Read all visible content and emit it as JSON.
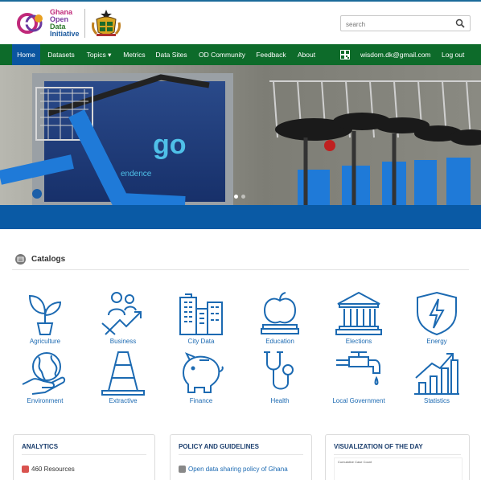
{
  "header": {
    "logo_lines": [
      "Ghana",
      "Open",
      "Data",
      "Initiative"
    ],
    "search_placeholder": "search"
  },
  "nav": {
    "items": [
      {
        "label": "Home",
        "active": true
      },
      {
        "label": "Datasets"
      },
      {
        "label": "Topics ▾"
      },
      {
        "label": "Metrics"
      },
      {
        "label": "Data Sites"
      },
      {
        "label": "OD Community"
      },
      {
        "label": "Feedback"
      },
      {
        "label": "About"
      }
    ],
    "user_email": "wisdom.dk@gmail.com",
    "logout": "Log out"
  },
  "hero": {
    "sign_text": "go",
    "sign_sub": "endence",
    "slides": 2,
    "active_slide": 0
  },
  "catalogs": {
    "title": "Catalogs",
    "items": [
      {
        "label": "Agriculture",
        "icon": "plant-icon"
      },
      {
        "label": "Business",
        "icon": "business-growth-icon"
      },
      {
        "label": "City Data",
        "icon": "city-buildings-icon"
      },
      {
        "label": "Education",
        "icon": "apple-books-icon"
      },
      {
        "label": "Elections",
        "icon": "government-building-icon"
      },
      {
        "label": "Energy",
        "icon": "lightning-shield-icon"
      },
      {
        "label": "Environment",
        "icon": "globe-hand-icon"
      },
      {
        "label": "Extractive",
        "icon": "cone-icon"
      },
      {
        "label": "Finance",
        "icon": "piggy-bank-icon"
      },
      {
        "label": "Health",
        "icon": "stethoscope-icon"
      },
      {
        "label": "Local Government",
        "icon": "water-tap-icon"
      },
      {
        "label": "Statistics",
        "icon": "bar-chart-icon"
      }
    ]
  },
  "panels": {
    "analytics": {
      "title": "ANALYTICS",
      "row": "460 Resources"
    },
    "policy": {
      "title": "POLICY AND GUIDELINES",
      "row": "Open data sharing policy of Ghana"
    },
    "viz": {
      "title": "VISUALIZATION OF THE DAY",
      "chart_title": "Cumulative Case Count"
    }
  },
  "colors": {
    "nav_green": "#0d6b2a",
    "nav_active": "#0a55a0",
    "icon_blue": "#1c6ab2",
    "hero_band": "#0a5aa5"
  }
}
